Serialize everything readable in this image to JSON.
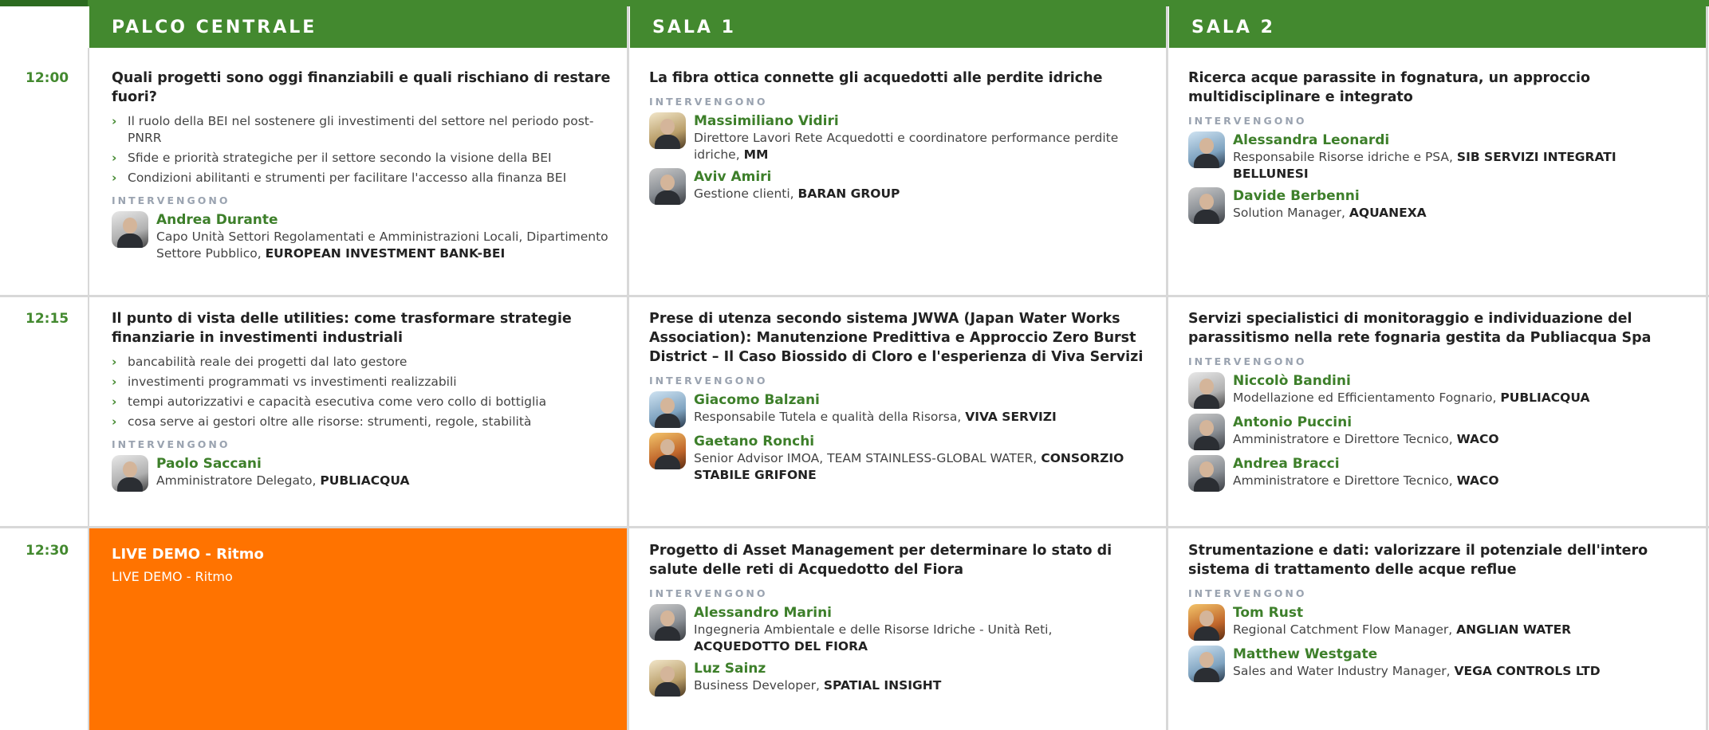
{
  "columns": [
    "PALCO CENTRALE",
    "SALA 1",
    "SALA 2"
  ],
  "times": [
    "12:00",
    "12:15",
    "12:30"
  ],
  "interv_label": "INTERVENGONO",
  "slots": {
    "s1200": {
      "palco": {
        "title": "Quali progetti sono oggi finanziabili e quali rischiano di restare fuori?",
        "bullets": [
          "Il ruolo della BEI nel sostenere gli investimenti del settore nel periodo post-PNRR",
          "Sfide e priorità strategiche per il settore secondo la visione della BEI",
          "Condizioni abilitanti e strumenti per facilitare l'accesso alla finanza BEI"
        ],
        "speakers": [
          {
            "name": "Andrea Durante",
            "role": "Capo Unità Settori Regolamentati e Amministrazioni Locali, Dipartimento Settore Pubblico,",
            "org": "EUROPEAN INVESTMENT BANK-BEI"
          }
        ]
      },
      "sala1": {
        "title": "La fibra ottica connette gli acquedotti alle perdite idriche",
        "speakers": [
          {
            "name": "Massimiliano Vidiri",
            "role": "Direttore Lavori Rete Acquedotti e coordinatore performance perdite idriche,",
            "org": "MM"
          },
          {
            "name": "Aviv Amiri",
            "role": "Gestione clienti,",
            "org": "BARAN GROUP"
          }
        ]
      },
      "sala2": {
        "title": "Ricerca acque parassite in fognatura, un approccio multidisciplinare e integrato",
        "speakers": [
          {
            "name": "Alessandra Leonardi",
            "role": "Responsabile Risorse idriche e PSA,",
            "org": "SIB SERVIZI INTEGRATI BELLUNESI"
          },
          {
            "name": "Davide Berbenni",
            "role": "Solution Manager,",
            "org": "AQUANEXA"
          }
        ]
      }
    },
    "s1215": {
      "palco": {
        "title": "Il punto di vista delle utilities: come trasformare strategie finanziarie in investimenti industriali",
        "bullets": [
          "bancabilità reale dei progetti dal lato gestore",
          "investimenti programmati vs investimenti realizzabili",
          "tempi autorizzativi e capacità esecutiva come vero collo di bottiglia",
          "cosa serve ai gestori oltre alle risorse: strumenti, regole, stabilità"
        ],
        "speakers": [
          {
            "name": "Paolo Saccani",
            "role": "Amministratore Delegato,",
            "org": "PUBLIACQUA"
          }
        ]
      },
      "sala1": {
        "title": "Prese di utenza secondo sistema JWWA (Japan Water Works Association): Manutenzione Predittiva e Approccio Zero Burst District – Il Caso Biossido di Cloro e l'esperienza di Viva Servizi",
        "speakers": [
          {
            "name": "Giacomo Balzani",
            "role": "Responsabile Tutela e qualità della Risorsa,",
            "org": "VIVA SERVIZI"
          },
          {
            "name": "Gaetano Ronchi",
            "role": "Senior Advisor IMOA, TEAM STAINLESS-GLOBAL WATER,",
            "org": "CONSORZIO STABILE GRIFONE"
          }
        ]
      },
      "sala2": {
        "title": "Servizi specialistici di monitoraggio e individuazione del parassitismo nella rete fognaria gestita da Publiacqua Spa",
        "speakers": [
          {
            "name": "Niccolò Bandini",
            "role": "Modellazione ed Efficientamento Fognario,",
            "org": "PUBLIACQUA"
          },
          {
            "name": "Antonio Puccini",
            "role": "Amministratore e Direttore Tecnico,",
            "org": "WACO"
          },
          {
            "name": "Andrea Bracci",
            "role": "Amministratore e Direttore Tecnico,",
            "org": "WACO"
          }
        ]
      }
    },
    "s1230": {
      "palco": {
        "live_title": "LIVE DEMO - Ritmo",
        "live_sub": "LIVE DEMO - Ritmo"
      },
      "sala1": {
        "title": "Progetto di Asset Management per determinare lo stato di salute delle reti di Acquedotto del Fiora",
        "speakers": [
          {
            "name": "Alessandro Marini",
            "role": "Ingegneria Ambientale e delle Risorse Idriche - Unità Reti,",
            "org": "ACQUEDOTTO DEL FIORA"
          },
          {
            "name": "Luz Sainz",
            "role": "Business Developer,",
            "org": "SPATIAL INSIGHT"
          }
        ]
      },
      "sala2": {
        "title": "Strumentazione e dati: valorizzare il potenziale dell'intero sistema di trattamento delle acque reflue",
        "speakers": [
          {
            "name": "Tom Rust",
            "role": "Regional Catchment Flow Manager,",
            "org": "ANGLIAN WATER"
          },
          {
            "name": "Matthew Westgate",
            "role": "Sales and Water Industry Manager,",
            "org": "VEGA CONTROLS LTD"
          }
        ]
      }
    }
  },
  "colors": {
    "green": "#43892f",
    "dark_green": "#2c6a20",
    "orange": "#ff7300",
    "name_green": "#3d7f2a",
    "label_grey": "#9aa3b0"
  }
}
